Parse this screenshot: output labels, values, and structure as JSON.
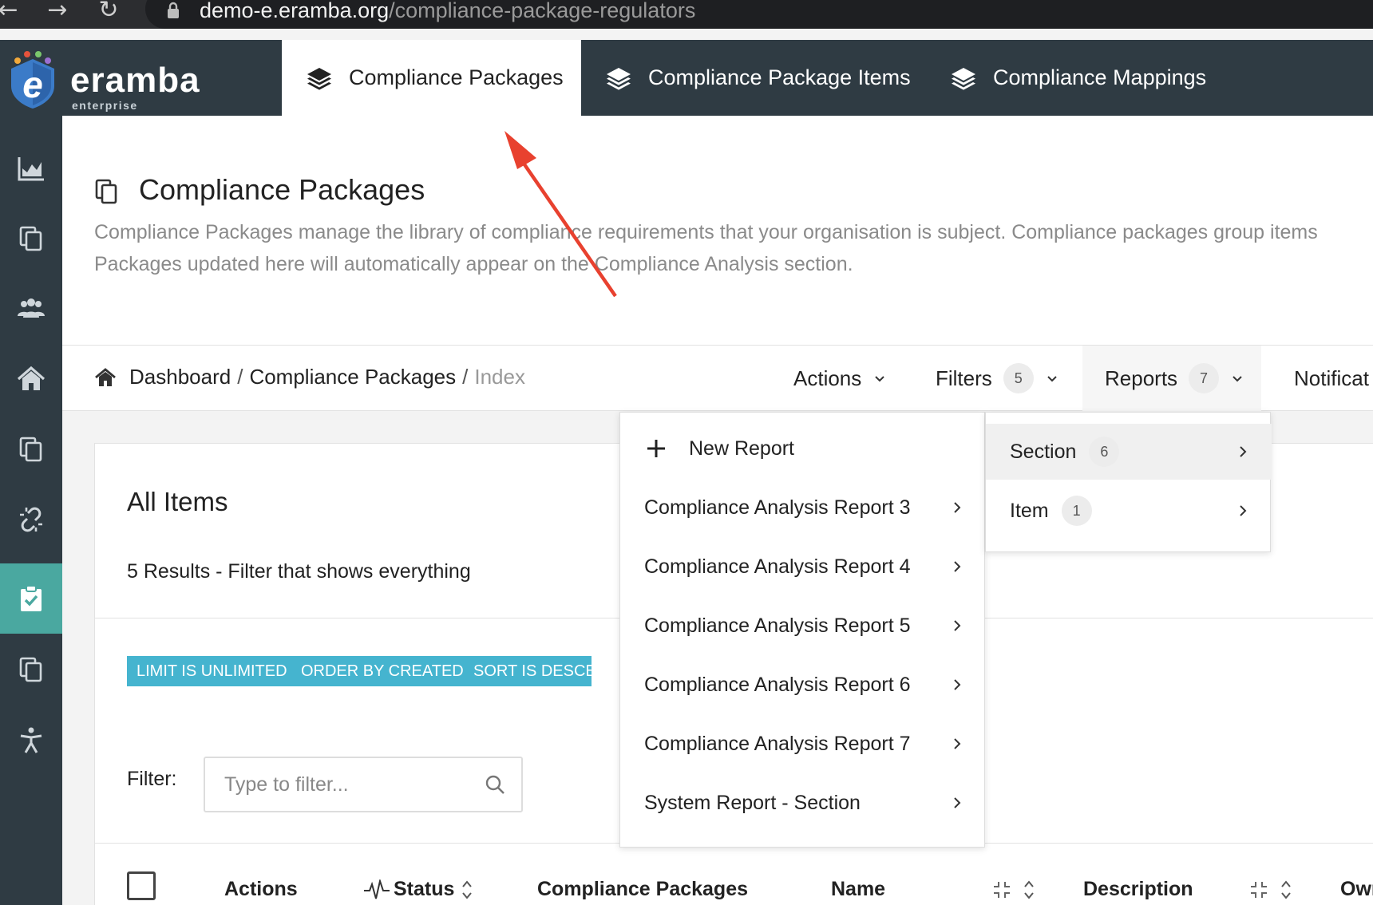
{
  "browser": {
    "url_host": "demo-e.eramba.org",
    "url_path": "/compliance-package-regulators"
  },
  "logo": {
    "name": "eramba",
    "edition": "enterprise"
  },
  "tabs": [
    {
      "label": "Compliance Packages",
      "active": true
    },
    {
      "label": "Compliance Package Items",
      "active": false
    },
    {
      "label": "Compliance Mappings",
      "active": false
    }
  ],
  "sidebar": {
    "items": [
      {
        "icon": "chart-area-icon"
      },
      {
        "icon": "copy-icon"
      },
      {
        "icon": "users-icon"
      },
      {
        "icon": "home-icon"
      },
      {
        "icon": "copy-icon"
      },
      {
        "icon": "unlink-icon"
      },
      {
        "icon": "clipboard-check-icon",
        "active": true
      },
      {
        "icon": "copy-icon"
      },
      {
        "icon": "accessibility-icon"
      }
    ]
  },
  "page": {
    "title": "Compliance Packages",
    "description_line1": "Compliance Packages manage the library of compliance requirements that your organisation is subject. Compliance packages group items",
    "description_line2": "Packages updated here will automatically appear on the Compliance Analysis section."
  },
  "breadcrumb": {
    "items": [
      "Dashboard",
      "Compliance Packages",
      "Index"
    ]
  },
  "toolbar": {
    "actions_label": "Actions",
    "filters_label": "Filters",
    "filters_count": "5",
    "reports_label": "Reports",
    "reports_count": "7",
    "notifications_label": "Notificat"
  },
  "card": {
    "title": "All Items",
    "subtitle": "5 Results - Filter that shows everything",
    "tags": [
      "LIMIT IS UNLIMITED",
      "ORDER BY CREATED",
      "SORT IS DESCENDING"
    ],
    "filter_label": "Filter:",
    "filter_placeholder": "Type to filter...",
    "columns": [
      "Actions",
      "Status",
      "Compliance Packages",
      "Name",
      "Description",
      "Owner"
    ]
  },
  "reports_menu": {
    "new_report": "New Report",
    "items": [
      "Compliance Analysis Report 3",
      "Compliance Analysis Report 4",
      "Compliance Analysis Report 5",
      "Compliance Analysis Report 6",
      "Compliance Analysis Report 7",
      "System Report - Section"
    ]
  },
  "reports_submenu": {
    "items": [
      {
        "label": "Section",
        "count": "6"
      },
      {
        "label": "Item",
        "count": "1"
      }
    ]
  },
  "colors": {
    "header_bg": "#2f3b43",
    "sidebar_active": "#4aa8a0",
    "tag_bg": "#45b4cf",
    "annotation_arrow": "#e8412f"
  }
}
